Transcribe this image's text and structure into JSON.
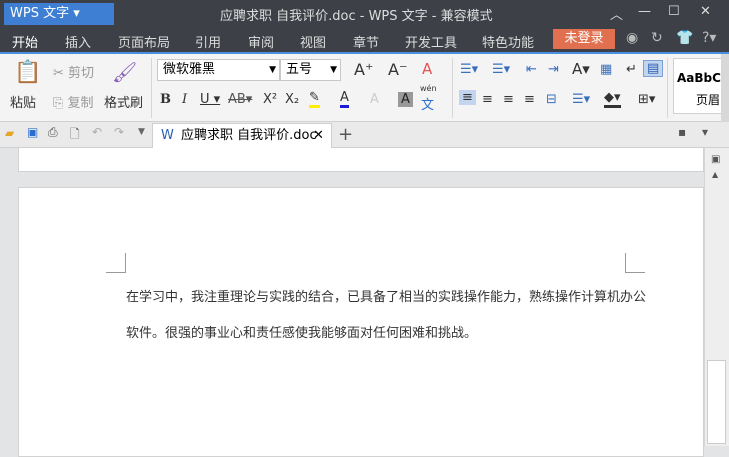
{
  "app": {
    "logo": "WPS 文字",
    "title": "应聘求职 自我评价.doc - WPS 文字 - 兼容模式"
  },
  "menu": [
    "开始",
    "插入",
    "页面布局",
    "引用",
    "审阅",
    "视图",
    "章节",
    "开发工具",
    "特色功能"
  ],
  "login": "未登录",
  "ribbon": {
    "paste": "粘贴",
    "cut": "剪切",
    "copy": "复制",
    "format_painter": "格式刷",
    "font": "微软雅黑",
    "size": "五号",
    "style_preview": "AaBbC",
    "style_label": "页眉",
    "pinyin": "wén",
    "pinyin_char": "文"
  },
  "doc_tab": "应聘求职 自我评价.doc",
  "document": {
    "lines": [
      "在学习中，我注重理论与实践的结合，已具备了相当的实践操作能力，熟练操作计算机办公",
      "软件。很强的事业心和责任感使我能够面对任何困难和挑战。"
    ]
  }
}
